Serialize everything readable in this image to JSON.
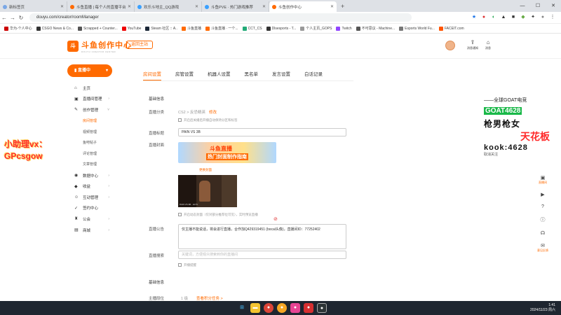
{
  "tabs": [
    {
      "label": "新标签页",
      "color": "#7aa7e6"
    },
    {
      "label": "斗鱼直播 | 每个人的直播平台",
      "color": "#ff6a00"
    },
    {
      "label": "欢乐斗地主_QQ游戏",
      "color": "#3aa0ff"
    },
    {
      "label": "斗鱼PVE · 热门游戏推荐",
      "color": "#3aa0ff"
    },
    {
      "label": "斗鱼创作中心",
      "color": "#ff6a00"
    }
  ],
  "url": "douyu.com/creator/roomManager",
  "bookmarks": [
    "华为-个人中心",
    "CSGO News & Co...",
    "Scrapped + Counter...",
    "YouTube",
    "Steam 社区 :: A..",
    "斗鱼直播",
    "斗鱼直播 · 一个...",
    "CCT_CS",
    "Dlsesports - T...",
    "个人主页_GOPS",
    "Twitch",
    "不可思议 - Machine...",
    "Esports World Fu...",
    "FACEIT.com"
  ],
  "header": {
    "logo": "斗鱼创作中心",
    "logo_sub": "DOUYU CREATOR CENTER",
    "back": "返回主站",
    "icon1": "消息通知",
    "icon2": "消息"
  },
  "sidebar": {
    "stream_button": "直播中",
    "items": [
      {
        "label": "主页",
        "icon": "⌂",
        "sub": false
      },
      {
        "label": "直播间管理",
        "icon": "▣",
        "sub": false,
        "chev": "›"
      },
      {
        "label": "创作管理",
        "icon": "✎",
        "sub": false,
        "chev": "˅"
      },
      {
        "label": "房间管理",
        "sub": true,
        "active": true
      },
      {
        "label": "视频管理",
        "sub": true
      },
      {
        "label": "鱼吧帖子",
        "sub": true
      },
      {
        "label": "评论管理",
        "sub": true
      },
      {
        "label": "文章管理",
        "sub": true
      },
      {
        "label": "数据中心",
        "icon": "◉",
        "sub": false,
        "chev": "›"
      },
      {
        "label": "收益",
        "icon": "◆",
        "sub": false,
        "chev": "›"
      },
      {
        "label": "互动管理",
        "icon": "☺",
        "sub": false,
        "chev": "›"
      },
      {
        "label": "签约中心",
        "icon": "✓",
        "sub": false
      },
      {
        "label": "公会",
        "icon": "♜",
        "sub": false,
        "chev": "›"
      },
      {
        "label": "商城",
        "icon": "▤",
        "sub": false,
        "chev": "›"
      }
    ]
  },
  "main": {
    "tabs": [
      "房间设置",
      "房管设置",
      "机器人设置",
      "黑名单",
      "发言设置",
      "白话记录"
    ],
    "section1": "基础信息",
    "category_label": "直播分类",
    "category_value": "CS2 > 反恐精英",
    "category_change": "修改",
    "category_note": "开启后关播后开播自动保持分区和标签",
    "title_label": "直播标题",
    "title_value": "PAIN VS 3B",
    "cover_label": "直播封面",
    "banner_title": "斗鱼直播",
    "banner_sub": "热门封面制作指南",
    "upload_label": "更换封面",
    "thumb_caption": "PAIN VS 3B · HLTV",
    "cover_note": "开启动态封面（仅对部分推荐位可见），实时预览直播",
    "notice_label": "直播公告",
    "notice_value": "仅主播不能说话，将会进行直播，合作加Q429319451 (bocal头像)，直播间ID：77252402",
    "search_label": "直播搜索",
    "search_placeholder": "关键词，方便观众搜索到你的直播间",
    "notify_label": "开播提醒",
    "section2": "基础信息",
    "level_label": "主播段位",
    "level_value": "1 级",
    "level_link": "查看积分任务 >"
  },
  "watermark": {
    "line1": "小助理vx：",
    "line2": "GPcsgow"
  },
  "overlay": {
    "l1": "——全球GOAT电竞",
    "l2": "GOAT4628",
    "l3": "枪男枪女",
    "l4": "天花板",
    "l5": "kook:4628",
    "l6": "取消关注"
  },
  "rightbar": [
    "直播间",
    "任务中心",
    "",
    "",
    "",
    "",
    "",
    "意见反馈"
  ],
  "clock": {
    "time": "1:41",
    "date": "2024/11/23 周六"
  }
}
